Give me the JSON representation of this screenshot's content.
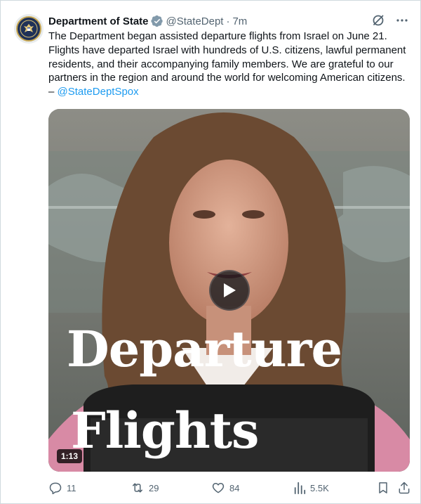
{
  "tweet": {
    "author_name": "Department of State",
    "handle": "@StateDept",
    "separator": "·",
    "time": "7m",
    "text": "The Department began assisted departure flights from Israel on June 21. Flights have departed Israel with hundreds of U.S. citizens, lawful permanent residents, and their accompanying family members. We are grateful to our partners in the region and around the world for welcoming American citizens. – ",
    "mention": "@StateDeptSpox",
    "verified_icon": "gray-verified-badge-icon"
  },
  "media": {
    "overlay_line1": "Departure",
    "overlay_line2": "Flights",
    "duration": "1:13",
    "play_icon": "play-icon"
  },
  "actions": {
    "replies": "11",
    "reposts": "29",
    "likes": "84",
    "views": "5.5K"
  },
  "colors": {
    "link": "#1d9bf0",
    "secondary_text": "#536471",
    "primary_text": "#0f1419",
    "border": "#cfd9de"
  }
}
